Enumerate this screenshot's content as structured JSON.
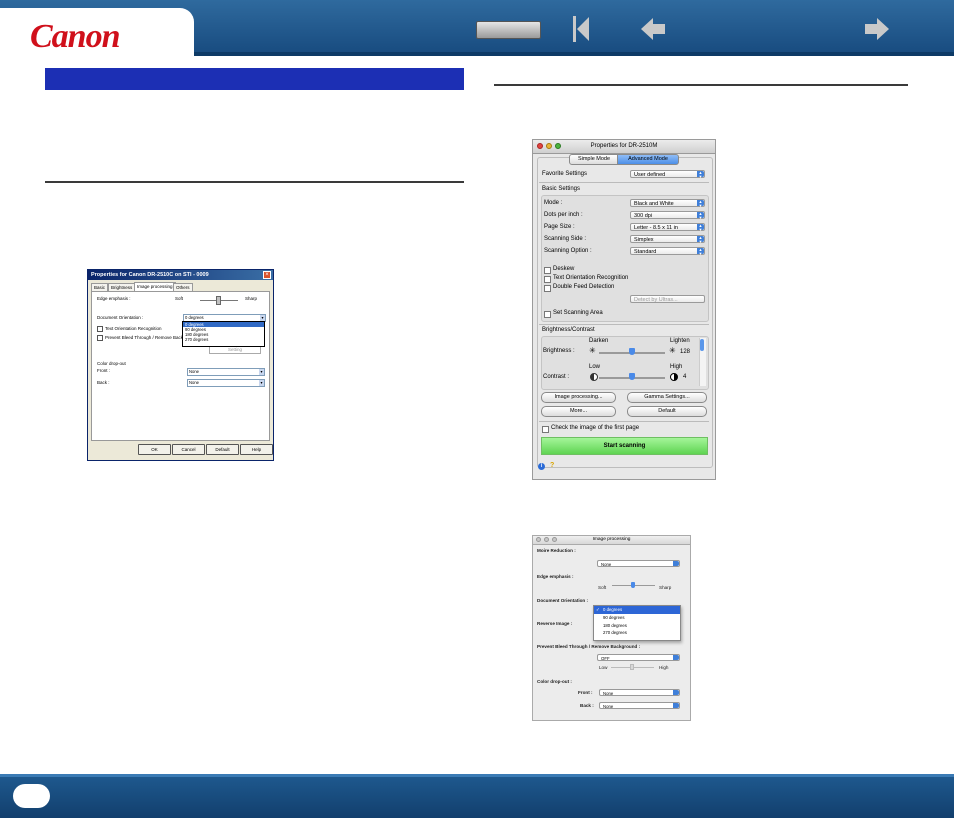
{
  "header": {
    "logo": "Canon",
    "nav": {
      "contents_label": "",
      "first_page": "first-page-icon",
      "prev_page": "back-arrow-icon",
      "next_page": "forward-arrow-icon"
    }
  },
  "colors": {
    "header": "#1d5287",
    "accent_bar": "#1c2fb4",
    "logo": "#d0101b"
  },
  "footer": {
    "page_number": ""
  },
  "win_dialog": {
    "title": "Properties for Canon DR-2510C on STI - 0009",
    "tabs": [
      "Basic",
      "Brightness",
      "Image processing",
      "Others"
    ],
    "edge_emphasis": "Edge emphasis :",
    "soft": "Soft",
    "sharp": "Sharp",
    "doc_orientation": "Document Orientation :",
    "doc_orientation_value": "0 degrees",
    "orientation_options": [
      "0 degrees",
      "90 degrees",
      "180 degrees",
      "270 degrees"
    ],
    "text_orientation": "Text Orientation Recognition",
    "prevent_bleed": "Prevent Bleed Through / Remove Back",
    "setting": "Setting",
    "color_dropout": "Color drop-out",
    "front": "Front :",
    "back": "Back :",
    "none": "None",
    "buttons": [
      "OK",
      "Cancel",
      "Default",
      "Help"
    ]
  },
  "mac_dialog": {
    "title": "Properties for DR-2510M",
    "modes": [
      "Simple Mode",
      "Advanced Mode"
    ],
    "favorite_label": "Favorite Settings",
    "favorite_value": "User defined",
    "basic_settings": "Basic Settings",
    "rows": [
      {
        "label": "Mode :",
        "value": "Black and White"
      },
      {
        "label": "Dots per inch :",
        "value": "300 dpi"
      },
      {
        "label": "Page Size :",
        "value": "Letter - 8.5 x 11 in"
      },
      {
        "label": "Scanning Side :",
        "value": "Simplex"
      },
      {
        "label": "Scanning Option :",
        "value": "Standard"
      }
    ],
    "deskew": "Deskew",
    "text_orientation": "Text Orientation Recognition",
    "double_feed": "Double Feed Detection",
    "detect_by": "Detect by Ultras...",
    "set_area": "Set Scanning Area",
    "brightness_contrast": "Brightness/Contrast",
    "darken": "Darken",
    "lighten": "Lighten",
    "brightness": "Brightness :",
    "brightness_value": "128",
    "brightness_level": 0.5,
    "low": "Low",
    "high": "High",
    "contrast": "Contrast :",
    "contrast_value": "4",
    "contrast_level": 0.5,
    "image_processing_btn": "Image processing...",
    "gamma_btn": "Gamma Settings...",
    "more_btn": "More...",
    "default_btn": "Default",
    "check_first_page": "Check the image of the first page",
    "start_scanning": "Start scanning"
  },
  "mac_image_processing": {
    "title": "Image processing",
    "moire": "Moire Reduction :",
    "moire_value": "None",
    "edge": "Edge emphasis :",
    "soft": "Soft",
    "sharp": "Sharp",
    "doc_orientation": "Document Orientation :",
    "orientation_options": [
      "0 degrees",
      "90 degrees",
      "180 degrees",
      "270 degrees"
    ],
    "selected_mark": "✓",
    "reverse": "Reverse Image :",
    "prevent_bleed": "Prevent Bleed Through / Remove Background :",
    "bleed_value": "OFF",
    "low": "Low",
    "high": "High",
    "color_dropout": "Color drop-out :",
    "front": "Front :",
    "back": "Back :",
    "none": "None"
  }
}
